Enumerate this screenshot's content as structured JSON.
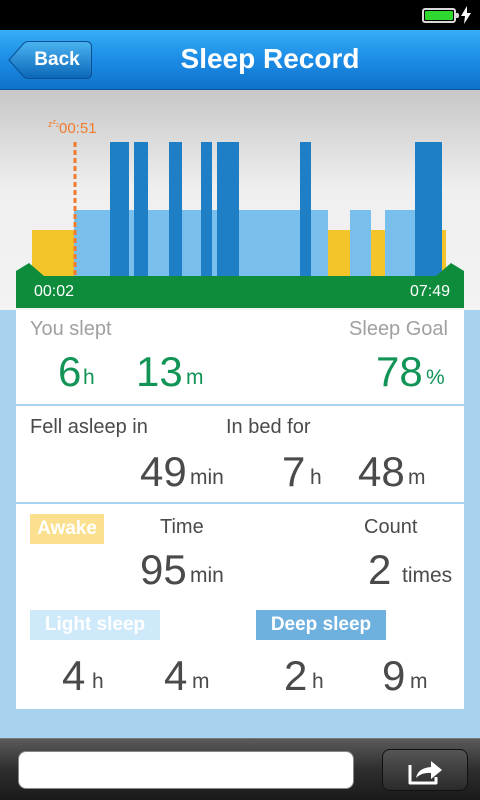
{
  "status_bar": {
    "battery_level": 1.0,
    "charging": true
  },
  "nav": {
    "back_label": "Back",
    "title": "Sleep Record"
  },
  "chart": {
    "onset_label": "00:51",
    "start_time": "00:02",
    "end_time": "07:49",
    "colors": {
      "awake": "#f3c52a",
      "light": "#79bfee",
      "deep": "#1f7fc6",
      "onset": "#ef7d2d",
      "timeline": "#0e8c3c"
    }
  },
  "summary": {
    "slept_label": "You slept",
    "slept_hours": "6",
    "slept_minutes": "13",
    "hour_unit": "h",
    "minute_unit": "m",
    "goal_label": "Sleep Goal",
    "goal_value": "78",
    "goal_unit": "%"
  },
  "timing": {
    "fell_asleep_label": "Fell asleep in",
    "fell_asleep_value": "49",
    "fell_asleep_unit": "min",
    "in_bed_label": "In bed for",
    "in_bed_hours": "7",
    "in_bed_minutes": "48",
    "hour_unit": "h",
    "minute_unit": "m"
  },
  "details": {
    "awake_label": "Awake",
    "time_label": "Time",
    "count_label": "Count",
    "awake_time": "95",
    "awake_time_unit": "min",
    "awake_count": "2",
    "awake_count_unit": "times",
    "light_label": "Light sleep",
    "light_hours": "4",
    "light_minutes": "4",
    "deep_label": "Deep sleep",
    "deep_hours": "2",
    "deep_minutes": "9",
    "hour_unit": "h",
    "minute_unit": "m"
  },
  "toolbar": {
    "comment_value": "",
    "share_icon": "share-arrow-icon"
  }
}
